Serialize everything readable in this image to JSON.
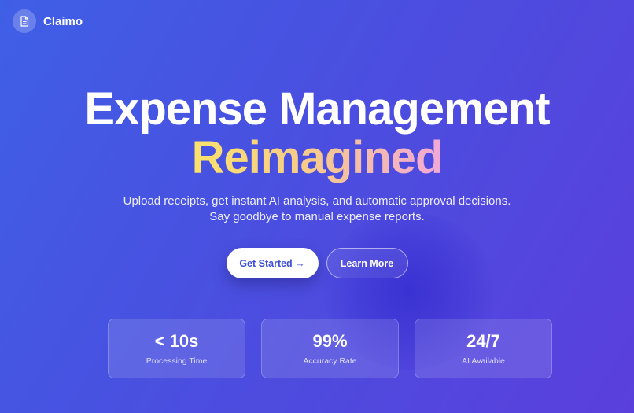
{
  "brand": {
    "name": "Claimo",
    "logo_icon": "document-icon"
  },
  "hero": {
    "headline": "Expense Management",
    "headline_accent": "Reimagined",
    "subtitle_line1": "Upload receipts, get instant AI analysis, and automatic approval decisions.",
    "subtitle_line2": "Say goodbye to manual expense reports."
  },
  "cta": {
    "primary_label": "Get Started →",
    "secondary_label": "Learn More"
  },
  "stats": [
    {
      "value": "< 10s",
      "label": "Processing Time"
    },
    {
      "value": "99%",
      "label": "Accuracy Rate"
    },
    {
      "value": "24/7",
      "label": "AI Available"
    }
  ],
  "colors": {
    "background_start": "#3f5fe6",
    "background_end": "#5a3fdc",
    "accent_gradient_start": "#fbe26b",
    "accent_gradient_end": "#f1a8d8",
    "primary_button_text": "#3d4fd8"
  }
}
